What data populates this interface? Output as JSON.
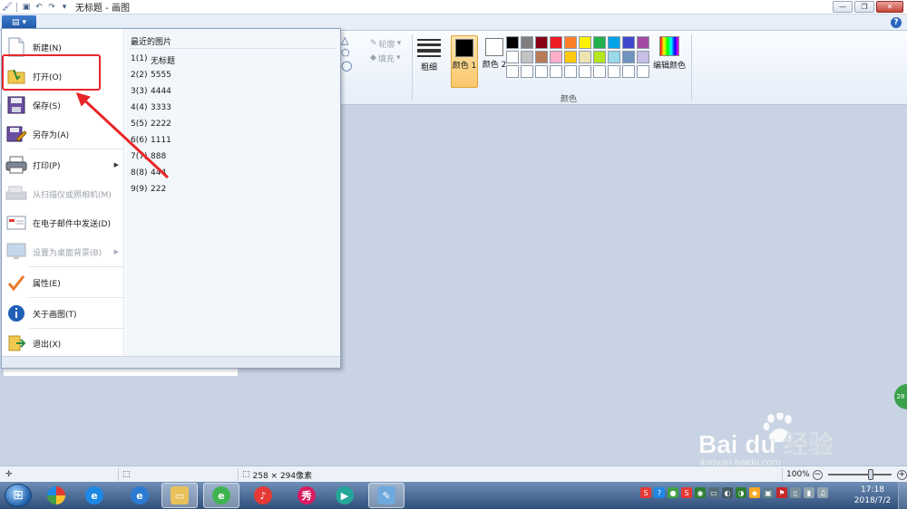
{
  "window": {
    "title": "无标题 - 画图"
  },
  "ribbon": {
    "outline_label": "轮廓",
    "fill_label": "填充",
    "thickness_label": "粗细",
    "color1_label": "颜色 1",
    "color2_label": "颜色 2",
    "edit_colors_label": "编辑颜色",
    "colors_group_label": "颜色",
    "color1_value": "#000000",
    "color2_value": "#ffffff",
    "palette": [
      "#000000",
      "#7f7f7f",
      "#880015",
      "#ed1c24",
      "#ff7f27",
      "#fff200",
      "#22b14c",
      "#00a2e8",
      "#3f48cc",
      "#a349a4",
      "#ffffff",
      "#c3c3c3",
      "#b97a57",
      "#ffaec9",
      "#ffc90e",
      "#efe4b0",
      "#b5e61d",
      "#99d9ea",
      "#7092be",
      "#c8bfe7",
      "#ffffff",
      "#ffffff",
      "#ffffff",
      "#ffffff",
      "#ffffff",
      "#ffffff",
      "#ffffff",
      "#ffffff",
      "#ffffff",
      "#ffffff"
    ]
  },
  "app_menu": {
    "items": [
      {
        "label": "新建(N)",
        "icon": "new-file-icon",
        "enabled": true
      },
      {
        "label": "打开(O)",
        "icon": "open-folder-icon",
        "enabled": true
      },
      {
        "label": "保存(S)",
        "icon": "save-disk-icon",
        "enabled": true
      },
      {
        "label": "另存为(A)",
        "icon": "save-as-icon",
        "enabled": true
      },
      {
        "label": "打印(P)",
        "icon": "printer-icon",
        "enabled": true,
        "submenu": true
      },
      {
        "label": "从扫描仪或照相机(M)",
        "icon": "scanner-icon",
        "enabled": false
      },
      {
        "label": "在电子邮件中发送(D)",
        "icon": "email-icon",
        "enabled": true
      },
      {
        "label": "设置为桌面背景(B)",
        "icon": "desktop-background-icon",
        "enabled": false,
        "submenu": true
      },
      {
        "label": "属性(E)",
        "icon": "checkmark-icon",
        "enabled": true
      },
      {
        "label": "关于画图(T)",
        "icon": "info-icon",
        "enabled": true
      },
      {
        "label": "退出(X)",
        "icon": "exit-icon",
        "enabled": true
      }
    ],
    "recent_title": "最近的图片",
    "recent": [
      {
        "num": "1(1)",
        "name": "无标题"
      },
      {
        "num": "2(2)",
        "name": "5555"
      },
      {
        "num": "3(3)",
        "name": "4444"
      },
      {
        "num": "4(4)",
        "name": "3333"
      },
      {
        "num": "5(5)",
        "name": "2222"
      },
      {
        "num": "6(6)",
        "name": "1111"
      },
      {
        "num": "7(7)",
        "name": "888"
      },
      {
        "num": "8(8)",
        "name": "444"
      },
      {
        "num": "9(9)",
        "name": "222"
      }
    ]
  },
  "status": {
    "canvas_size": "258 × 294像素",
    "zoom": "100%"
  },
  "taskbar": {
    "time": "17:18",
    "date": "2018/7/2",
    "side_badge": "28"
  },
  "watermark": {
    "brand": "Bai du 经验",
    "url": "jingyan.baidu.com"
  },
  "colors": {
    "highlight_red": "#e8262a",
    "arrow_red": "#e8262a",
    "ribbon_blue": "#1d56a6"
  }
}
